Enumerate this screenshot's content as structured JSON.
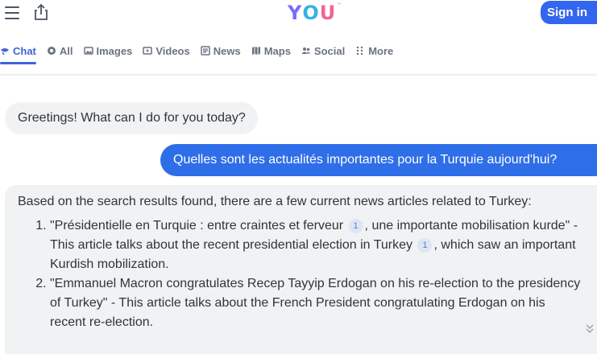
{
  "header": {
    "logo_text": [
      "Y",
      "O",
      "U"
    ],
    "logo_tm": "™",
    "signin_label": "Sign in",
    "colors": {
      "signin_bg": "#3366ee",
      "logo_y": "#7c6cf6",
      "logo_o": "#34b3e4",
      "logo_u": "#f06595"
    }
  },
  "tabs": [
    {
      "label": "Chat",
      "icon": "chat-icon",
      "active": true
    },
    {
      "label": "All",
      "icon": "search-icon",
      "active": false
    },
    {
      "label": "Images",
      "icon": "images-icon",
      "active": false
    },
    {
      "label": "Videos",
      "icon": "videos-icon",
      "active": false
    },
    {
      "label": "News",
      "icon": "news-icon",
      "active": false
    },
    {
      "label": "Maps",
      "icon": "map-icon",
      "active": false
    },
    {
      "label": "Social",
      "icon": "people-icon",
      "active": false
    },
    {
      "label": "More",
      "icon": "grid-dots-icon",
      "active": false
    }
  ],
  "chat": {
    "greeting": "Greetings! What can I do for you today?",
    "user_message": "Quelles sont les actualités importantes pour la Turquie aujourd'hui?",
    "answer": {
      "intro": "Based on the search results found, there are a few current news articles related to Turkey:",
      "items": [
        {
          "part1": "\"Présidentielle en Turquie : entre craintes et ferveur",
          "cite1": "1",
          "part2": ", une importante mobilisation kurde\" - This article talks about the recent presidential election in Turkey",
          "cite2": "1",
          "part3": ", which saw an important Kurdish mobilization."
        },
        {
          "text": "\"Emmanuel Macron congratulates Recep Tayyip Erdogan on his re-election to the presidency of Turkey\" - This article talks about the French President congratulating Erdogan on his recent re-election."
        }
      ]
    }
  }
}
